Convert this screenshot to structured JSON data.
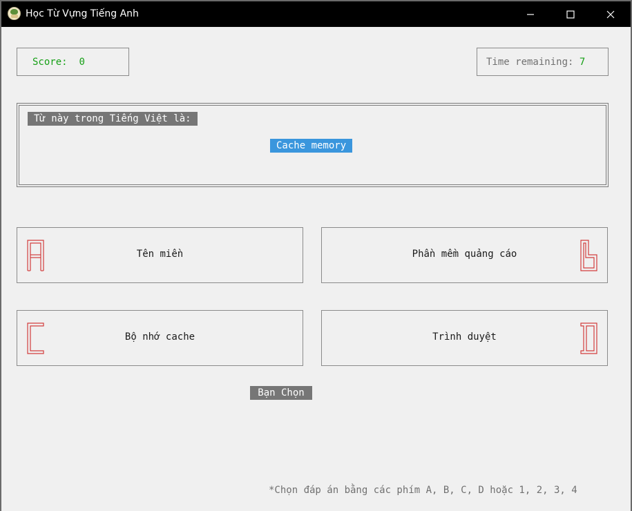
{
  "window": {
    "title": "Học Từ Vựng Tiếng Anh",
    "icon": "app-logo-icon",
    "controls": [
      "minimize-icon",
      "maximize-icon",
      "close-icon"
    ]
  },
  "score": {
    "label": "Score:",
    "value": "0"
  },
  "timer": {
    "label": "Time remaining:",
    "value": "7"
  },
  "question": {
    "prompt": "Từ này trong Tiếng Việt là:",
    "word": "Cache memory"
  },
  "options": [
    {
      "key": "A",
      "text": "Tên miền"
    },
    {
      "key": "B",
      "text": "Phần mềm quảng cáo"
    },
    {
      "key": "C",
      "text": "Bộ nhớ cache"
    },
    {
      "key": "D",
      "text": "Trình duyệt"
    }
  ],
  "choice_label": "Bạn Chọn",
  "hint": "*Chọn đáp án bằng các phím A, B, C, D hoặc 1, 2, 3, 4",
  "colors": {
    "score": "#16a016",
    "word_highlight": "#3a96dd",
    "letter_icons": "#d23c3c",
    "label_bg": "#767676"
  }
}
